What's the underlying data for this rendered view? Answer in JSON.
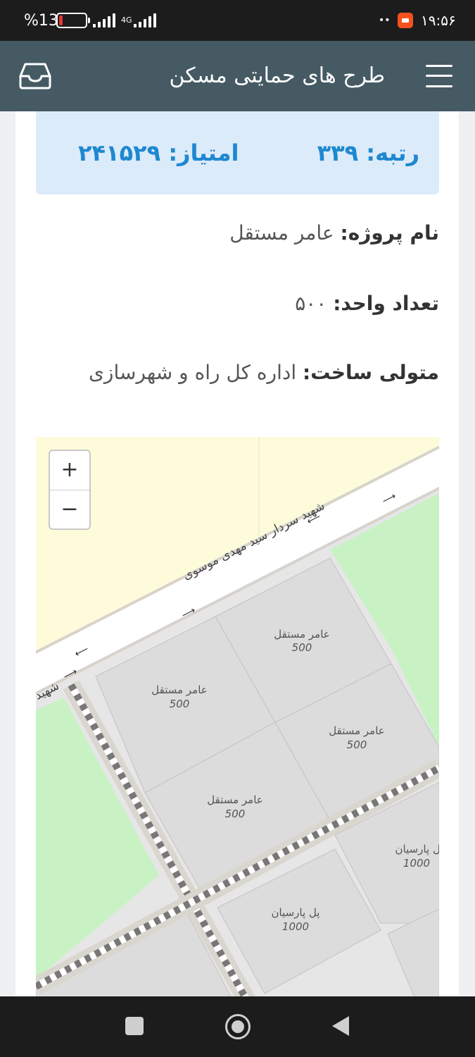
{
  "status_bar": {
    "time": "۱۹:۵۶",
    "dots": "••",
    "battery_percent": "%13",
    "network": "4G",
    "battery_level": 0.13
  },
  "app_bar": {
    "title": "طرح های حمایتی مسکن",
    "menu_icon": "hamburger-menu-icon",
    "inbox_icon": "inbox-tray-icon"
  },
  "project": {
    "rank_text": "رتبه: ۳۳۹",
    "score_text": "امتیاز: ۲۴۱۵۲۹",
    "name_label": "نام پروژه:",
    "name_value": "عامر مستقل",
    "units_label": "تعداد واحد:",
    "units_value": "۵۰۰",
    "builder_label": "متولی ساخت:",
    "builder_value": "اداره کل راه و شهرسازی"
  },
  "map": {
    "zoom_in": "+",
    "zoom_out": "−",
    "street_main": "شهید سردار سید مهدی موسوی",
    "street_short": "شهید",
    "parcels": [
      {
        "name": "عامر مستقل",
        "units": "500"
      },
      {
        "name": "عامر مستقل",
        "units": "500"
      },
      {
        "name": "عامر مستقل",
        "units": "500"
      },
      {
        "name": "عامر مستقل",
        "units": "500"
      },
      {
        "name": "پل پارسیان",
        "units": "1000"
      },
      {
        "name": "پل پارسیان",
        "units": "1000"
      }
    ],
    "colors": {
      "background": "#fdfbd9",
      "park": "#c8f2c4",
      "parcel": "#dcdcdc",
      "road": "#ffffff"
    }
  }
}
